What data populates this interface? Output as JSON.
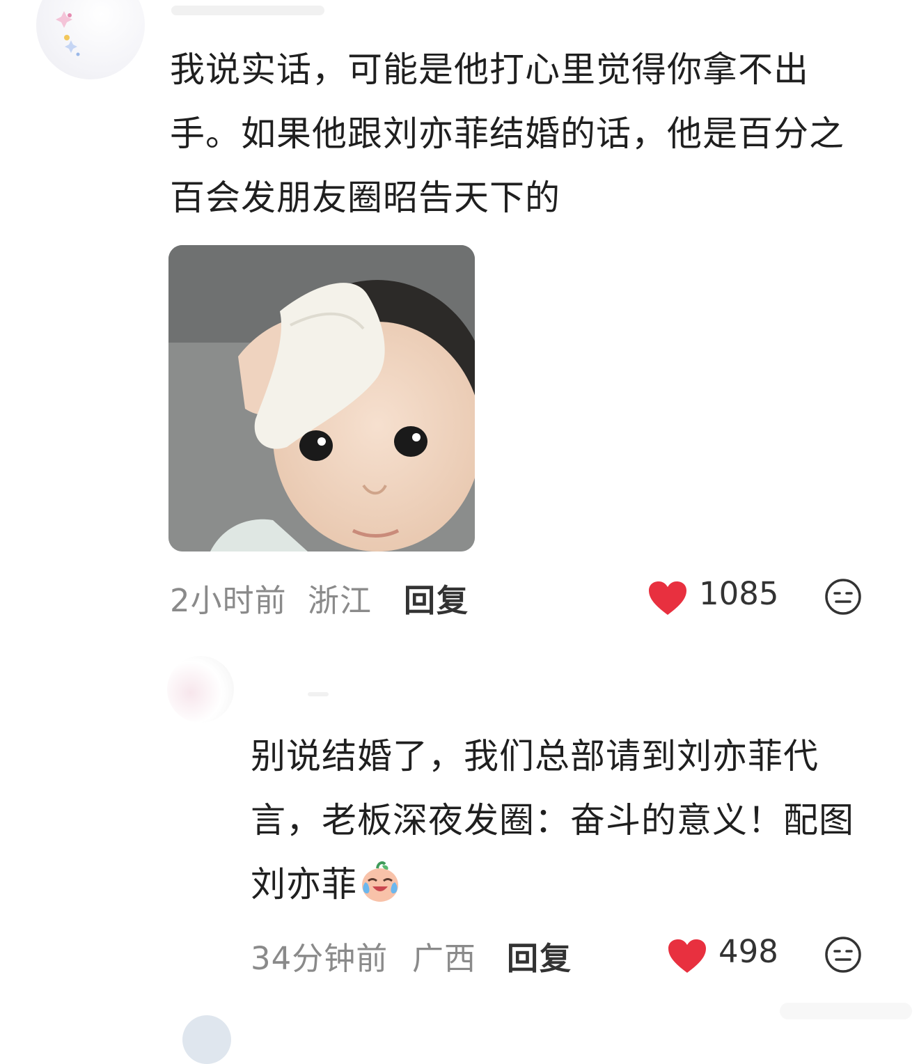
{
  "comments": [
    {
      "text": "我说实话，可能是他打心里觉得你拿不出手。如果他跟刘亦菲结婚的话，他是百分之百会发朋友圈昭告天下的",
      "time": "2小时前",
      "location": "浙江",
      "reply_label": "回复",
      "likes": "1085",
      "image_icon": "baby-with-towel-photo"
    },
    {
      "text": "别说结婚了，我们总部请到刘亦菲代言，老板深夜发圈：奋斗的意义！配图刘亦菲",
      "emoji": "crying-laughing-emoji",
      "time": "34分钟前",
      "location": "广西",
      "reply_label": "回复",
      "likes": "498"
    }
  ],
  "icons": {
    "like": "heart-icon",
    "reaction": "neutral-face-icon"
  },
  "colors": {
    "like": "#e8303f",
    "meta": "#8a8a8a",
    "text": "#1f1f1f"
  }
}
